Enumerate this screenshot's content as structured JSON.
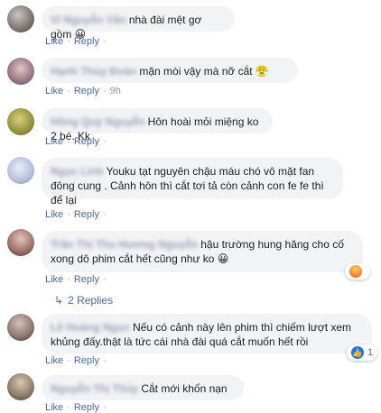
{
  "comments": [
    {
      "author": "Vi Nguyễn Vân",
      "text": "nhà đài mệt gơ gồm 😀",
      "like": "Like",
      "reply": "Reply",
      "time": ""
    },
    {
      "author": "Hạnh Thùy Đoàn",
      "text": "mặn mòi vậy mà nỡ cắt 😤",
      "like": "Like",
      "reply": "Reply",
      "time": "9h"
    },
    {
      "author": "Hồng Quý Nguyễn",
      "text": "Hôn hoài mỏi miệng ko 2 bé. Kk",
      "like": "Like",
      "reply": "Reply",
      "time": ""
    },
    {
      "author": "Ngọc Linh",
      "text": "Youku tạt nguyên chậu máu chó vô mặt fan đông cung . Cảnh hôn thì cắt tơi tả còn cảnh con fe fe thì để lại",
      "like": "Like",
      "reply": "Reply",
      "time": ""
    },
    {
      "author": "Trần Thị Thu Hương Nguyễn",
      "text": "hậu trường hung hăng cho cố xong dô phim cắt hết cũng như ko 😀",
      "like": "Like",
      "reply": "Reply",
      "time": "",
      "reaction_count": "",
      "reply_count": "2 Replies"
    },
    {
      "author": "Lê Hoàng Ngọc",
      "text": "Nếu có cảnh này lên phim thì chiếm lượt xem khủng đấy.thật là tức cái nhà đài quá cắt muốn hết rồi",
      "like": "Like",
      "reply": "Reply",
      "time": "",
      "reaction_count": "1"
    },
    {
      "author": "Nguyễn Thị Thúy",
      "text": "Cắt mới khốn nạn",
      "like": "Like",
      "reply": "Reply",
      "time": ""
    }
  ],
  "colors": {
    "link": "#4b67a1",
    "bubble": "#f2f3f5",
    "meta": "#90949c"
  }
}
